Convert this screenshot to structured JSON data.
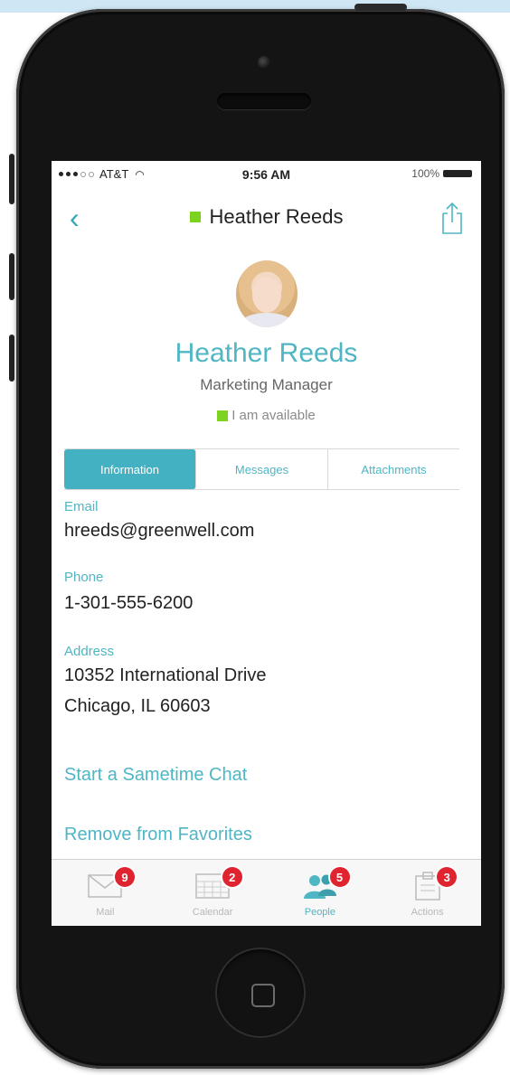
{
  "status_bar": {
    "carrier": "AT&T",
    "time": "9:56 AM",
    "battery": "100%"
  },
  "nav": {
    "title": "Heather Reeds"
  },
  "profile": {
    "name": "Heather Reeds",
    "role": "Marketing Manager",
    "availability": "I am available"
  },
  "tabs": [
    {
      "label": "Information",
      "active": true
    },
    {
      "label": "Messages",
      "active": false
    },
    {
      "label": "Attachments",
      "active": false
    }
  ],
  "info": {
    "email_label": "Email",
    "email": "hreeds@greenwell.com",
    "phone_label": "Phone",
    "phone": "1-301-555-6200",
    "address_label": "Address",
    "address_line1": "10352 International Drive",
    "address_line2": "Chicago, IL 60603"
  },
  "actions": {
    "chat": "Start a Sametime Chat",
    "favorites": "Remove from Favorites"
  },
  "tab_bar": [
    {
      "label": "Mail",
      "badge": "9",
      "icon": "mail-icon",
      "active": false
    },
    {
      "label": "Calendar",
      "badge": "2",
      "icon": "calendar-icon",
      "active": false
    },
    {
      "label": "People",
      "badge": "5",
      "icon": "people-icon",
      "active": true
    },
    {
      "label": "Actions",
      "badge": "3",
      "icon": "actions-icon",
      "active": false
    }
  ],
  "colors": {
    "accent": "#4fb6c4",
    "available": "#7ed321",
    "badge": "#e0242f"
  }
}
